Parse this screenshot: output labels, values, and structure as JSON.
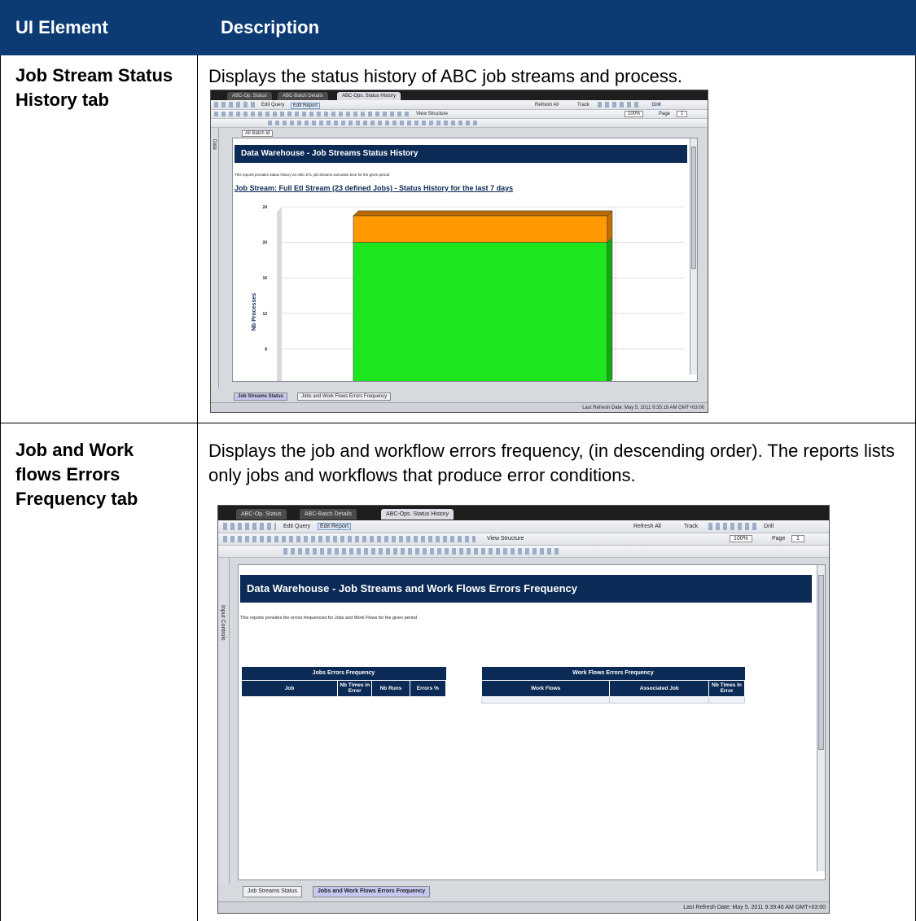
{
  "header": {
    "col1": "UI Element",
    "col2": "Description"
  },
  "rows": [
    {
      "element": "Job Stream Status History tab",
      "description": "Displays the status history of ABC job streams and process.",
      "screenshot": {
        "tabs": [
          "ABC-Op. Status",
          "ABC-Batch Details",
          "ABC-Ops. Status History"
        ],
        "toolbar": {
          "edit_query": "Edit Query",
          "edit_report": "Edit Report",
          "refresh_all": "Refresh All",
          "track": "Track",
          "drill": "Drill",
          "view_structure": "View Structure",
          "zoom": "100%",
          "page_label": "Page",
          "page_value": "1"
        },
        "filter_label": "All Batch Id",
        "side_label": "Data",
        "banner": "Data Warehouse - Job Streams Status History",
        "intro": "This reports provides status history on ABC ETL job streams execution time for the given period",
        "subtitle": "Job Stream: Full Etl Stream (23 defined Jobs) -  Status History for the last 7 days",
        "bottom_tabs": [
          "Job Streams Status",
          "Jobs and Work Flows Errors Frequency"
        ],
        "status": "Last Refresh Date: May 5, 2011 9:35:19 AM GMT+03:00"
      }
    },
    {
      "element": "Job and Work flows Errors Frequency tab",
      "description": "Displays the job and workflow errors frequency, (in descending order). The reports lists only jobs and workflows that produce error conditions.",
      "screenshot": {
        "tabs": [
          "ABC-Op. Status",
          "ABC-Batch Details",
          "ABC-Ops. Status History"
        ],
        "toolbar": {
          "edit_query": "Edit Query",
          "edit_report": "Edit Report",
          "refresh_all": "Refresh All",
          "track": "Track",
          "drill": "Drill",
          "view_structure": "View Structure",
          "zoom": "100%",
          "page_label": "Page",
          "page_value": "1"
        },
        "side_label": "Input Controls",
        "banner": "Data Warehouse - Job Streams and Work Flows Errors Frequency",
        "intro": "This reports provides the errors frequencies for Jobs and Work Flows for the given period",
        "jobs_table": {
          "title": "Jobs Errors Frequency",
          "columns": [
            "Job",
            "Nb Times in Error",
            "Nb Runs",
            "Errors %"
          ]
        },
        "wf_table": {
          "title": "Work Flows Errors Frequency",
          "columns": [
            "Work Flows",
            "Associated Job",
            "Nb Times In Error"
          ]
        },
        "bottom_tabs": [
          "Job Streams Status",
          "Jobs and Work Flows Errors Frequency"
        ],
        "status": "Last Refresh Date: May 5, 2011 9:39:46 AM GMT+03:00"
      }
    }
  ],
  "chart_data": {
    "type": "bar",
    "ylabel": "Nb Processes",
    "yticks": [
      8,
      12,
      16,
      20,
      24
    ],
    "ylim": [
      4,
      24
    ],
    "series": [
      {
        "values": [
          20
        ]
      },
      {
        "values": [
          3
        ]
      }
    ],
    "colors": [
      "#1ee61e",
      "#ff9900"
    ]
  }
}
